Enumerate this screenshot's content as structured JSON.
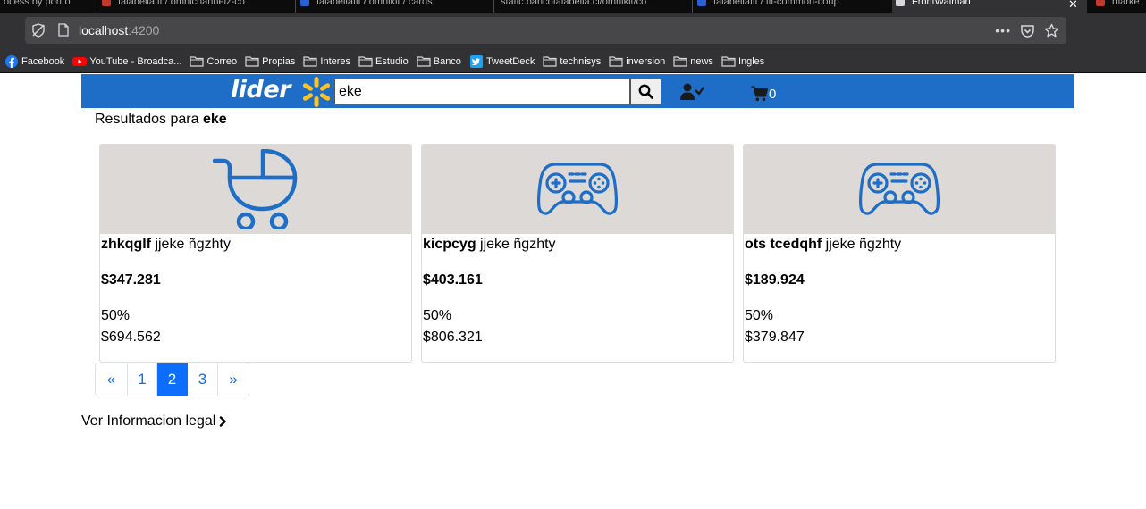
{
  "browser": {
    "tabs": [
      {
        "title": "ocess by port o"
      },
      {
        "title": "falabellafif / omnichannelz-co"
      },
      {
        "title": "falabellafif / omnikit / cards"
      },
      {
        "title": "static.bancofalabella.cl/omnikit/co"
      },
      {
        "title": "falabellafif / fif-common-coup"
      },
      {
        "title": "FrontWalmart"
      },
      {
        "title": "marke"
      }
    ],
    "url_host": "localhost",
    "url_port": ":4200",
    "bookmarks": [
      {
        "label": "Facebook",
        "icon": "facebook-icon"
      },
      {
        "label": "YouTube - Broadca...",
        "icon": "youtube-icon"
      },
      {
        "label": "Correo",
        "icon": "folder-icon"
      },
      {
        "label": "Propias",
        "icon": "folder-icon"
      },
      {
        "label": "Interes",
        "icon": "folder-icon"
      },
      {
        "label": "Estudio",
        "icon": "folder-icon"
      },
      {
        "label": "Banco",
        "icon": "folder-icon"
      },
      {
        "label": "TweetDeck",
        "icon": "twitter-icon"
      },
      {
        "label": "technisys",
        "icon": "folder-icon"
      },
      {
        "label": "inversion",
        "icon": "folder-icon"
      },
      {
        "label": "news",
        "icon": "folder-icon"
      },
      {
        "label": "Ingles",
        "icon": "folder-icon"
      }
    ]
  },
  "header": {
    "logo_text": "lider",
    "search_value": "eke",
    "cart_count": "0",
    "colors": {
      "brand_blue": "#1e6ec8",
      "spark_yellow": "#ffc220"
    }
  },
  "results": {
    "prefix": "Resultados para ",
    "query": "eke"
  },
  "products": [
    {
      "brand": "zhkqglf",
      "description": " jjeke ñgzhty",
      "price": "$347.281",
      "discount": "50%",
      "old_price": "$694.562",
      "icon": "baby-carriage-icon"
    },
    {
      "brand": "kicpcyg",
      "description": " jjeke ñgzhty",
      "price": "$403.161",
      "discount": "50%",
      "old_price": "$806.321",
      "icon": "gamepad-icon"
    },
    {
      "brand": "ots tcedqhf",
      "description": " jjeke ñgzhty",
      "price": "$189.924",
      "discount": "50%",
      "old_price": "$379.847",
      "icon": "gamepad-icon"
    }
  ],
  "pagination": {
    "prev": "«",
    "pages": [
      "1",
      "2",
      "3"
    ],
    "current": "2",
    "next": "»"
  },
  "footer": {
    "legal_link": "Ver Informacion legal"
  }
}
